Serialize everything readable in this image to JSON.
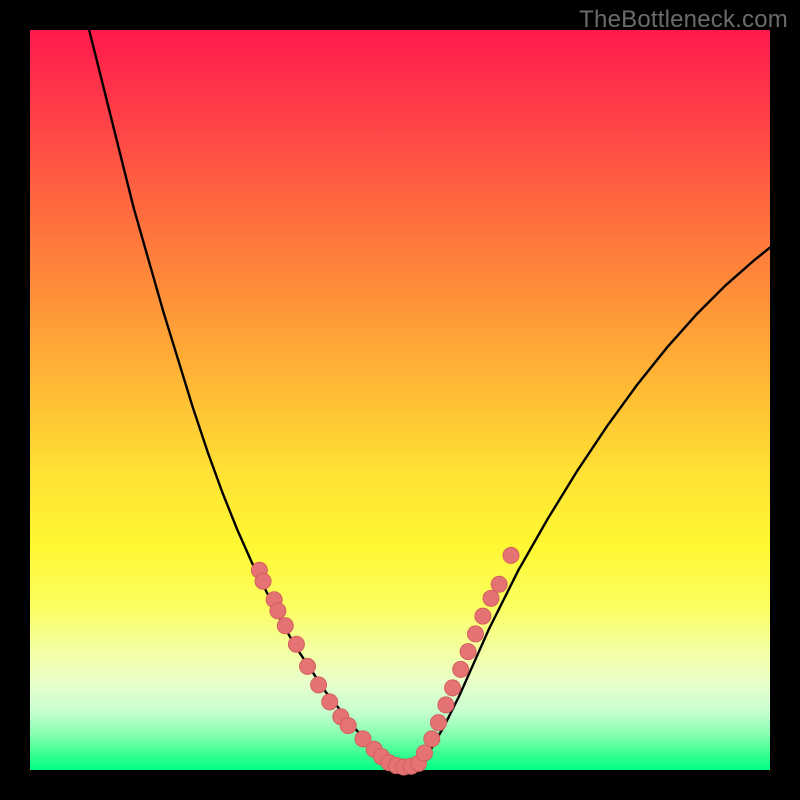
{
  "watermark": {
    "text": "TheBottleneck.com"
  },
  "colors": {
    "curve_stroke": "#000000",
    "marker_fill": "#e57373",
    "marker_stroke": "#d45f5f"
  },
  "chart_data": {
    "type": "line",
    "title": "",
    "xlabel": "",
    "ylabel": "",
    "xlim": [
      0,
      100
    ],
    "ylim": [
      0,
      100
    ],
    "grid": false,
    "legend": false,
    "series": [
      {
        "name": "bottleneck-curve",
        "x": [
          8,
          10,
          12,
          14,
          16,
          18,
          20,
          22,
          24,
          26,
          28,
          30,
          32,
          34,
          36,
          38,
          40,
          42,
          44,
          46,
          48,
          50,
          52,
          54,
          56,
          58,
          60,
          62,
          66,
          70,
          74,
          78,
          82,
          86,
          90,
          94,
          98,
          100
        ],
        "y": [
          100,
          92,
          84,
          76,
          69,
          62,
          55.5,
          49,
          43,
          37.5,
          32.5,
          28,
          24,
          20,
          16.5,
          13.5,
          10.5,
          8,
          5.5,
          3.5,
          1.8,
          0.6,
          0.6,
          2.5,
          6,
          10,
          14.5,
          19,
          27,
          34,
          40.5,
          46.5,
          52,
          57,
          61.5,
          65.5,
          69,
          70.6
        ]
      }
    ],
    "markers": [
      {
        "name": "cluster-left",
        "x": [
          31,
          31.5,
          33,
          33.5,
          34.5,
          36,
          37.5,
          39,
          40.5,
          42,
          43,
          45,
          46.5,
          47.5,
          48.5
        ],
        "y": [
          27,
          25.5,
          23,
          21.5,
          19.5,
          17,
          14,
          11.5,
          9.2,
          7.2,
          6,
          4.2,
          2.8,
          1.8,
          1.0
        ]
      },
      {
        "name": "valley",
        "x": [
          49.5,
          50.5,
          51.5,
          52.5
        ],
        "y": [
          0.6,
          0.4,
          0.5,
          0.9
        ]
      },
      {
        "name": "cluster-right",
        "x": [
          53.3,
          54.3,
          55.2,
          56.2,
          57.1,
          58.2,
          59.2,
          60.2,
          61.2,
          62.3,
          63.4
        ],
        "y": [
          2.3,
          4.2,
          6.4,
          8.8,
          11.1,
          13.6,
          16.0,
          18.4,
          20.8,
          23.2,
          25.1
        ]
      },
      {
        "name": "outlier-right",
        "x": [
          65.0
        ],
        "y": [
          29.0
        ]
      }
    ]
  }
}
